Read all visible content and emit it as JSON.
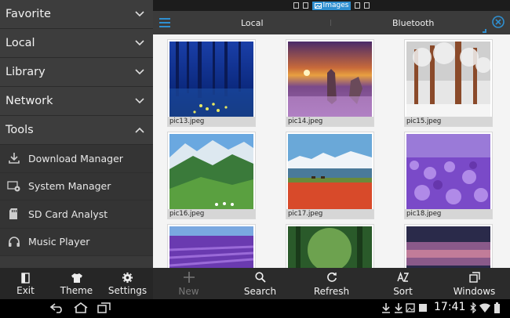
{
  "sidebar": {
    "categories": [
      {
        "label": "Favorite",
        "expanded": false
      },
      {
        "label": "Local",
        "expanded": false
      },
      {
        "label": "Library",
        "expanded": false
      },
      {
        "label": "Network",
        "expanded": false
      },
      {
        "label": "Tools",
        "expanded": true
      }
    ],
    "tools": [
      {
        "label": "Download Manager",
        "icon": "download-icon"
      },
      {
        "label": "System Manager",
        "icon": "system-gear-icon"
      },
      {
        "label": "SD Card Analyst",
        "icon": "sdcard-icon"
      },
      {
        "label": "Music Player",
        "icon": "headphones-icon"
      }
    ],
    "bottom": [
      {
        "label": "Exit",
        "icon": "exit-icon"
      },
      {
        "label": "Theme",
        "icon": "tshirt-icon"
      },
      {
        "label": "Settings",
        "icon": "gear-icon"
      }
    ]
  },
  "statusline": {
    "active_label": "Images"
  },
  "tabs": {
    "left": "Local",
    "right": "Bluetooth"
  },
  "grid": {
    "files": [
      {
        "name": "pic13.jpeg",
        "theme": "blue-forest"
      },
      {
        "name": "pic14.jpeg",
        "theme": "purple-lake-sunset"
      },
      {
        "name": "pic15.jpeg",
        "theme": "snowy-forest"
      },
      {
        "name": "pic16.jpeg",
        "theme": "green-mountains"
      },
      {
        "name": "pic17.jpeg",
        "theme": "red-field-mountains"
      },
      {
        "name": "pic18.jpeg",
        "theme": "lavender-field"
      },
      {
        "name": "",
        "theme": "lavender-rows"
      },
      {
        "name": "",
        "theme": "green-forest"
      },
      {
        "name": "",
        "theme": "dusk-sky"
      }
    ]
  },
  "actions": [
    {
      "label": "New",
      "icon": "plus-icon",
      "enabled": false
    },
    {
      "label": "Search",
      "icon": "search-icon",
      "enabled": true
    },
    {
      "label": "Refresh",
      "icon": "refresh-icon",
      "enabled": true
    },
    {
      "label": "Sort",
      "icon": "sort-icon",
      "enabled": true
    },
    {
      "label": "Windows",
      "icon": "windows-icon",
      "enabled": true
    }
  ],
  "system": {
    "time": "17:41"
  },
  "colors": {
    "accent": "#2f8fd0",
    "sidebar": "#3a3a3a",
    "content": "#f4f4f4",
    "bar": "#2b2b2b"
  }
}
